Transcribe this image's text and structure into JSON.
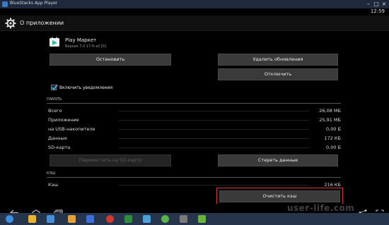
{
  "window": {
    "title": "BlueStacks App Player"
  },
  "status": {
    "time": "12:59"
  },
  "actionbar": {
    "title": "О приложении"
  },
  "app": {
    "name": "Play Маркет",
    "version": "Версия 7.0.17.H-all [0]"
  },
  "buttons": {
    "stop": "Остановить",
    "uninstall_updates": "Удалить обновления",
    "disable": "Отключить",
    "move_sd": "Переместить на SD-карту",
    "clear_data": "Стереть данные",
    "clear_cache": "Очистить кэш"
  },
  "notifications": {
    "label": "Включить уведомления",
    "checked": true
  },
  "memory": {
    "header": "ПАМЯТЬ",
    "rows": [
      {
        "label": "Всего",
        "value": "26,08 МБ"
      },
      {
        "label": "Приложение",
        "value": "25,91 МБ"
      },
      {
        "label": "на USB-накопителе",
        "value": "0,00 Б"
      },
      {
        "label": "Данные",
        "value": "172 КБ"
      },
      {
        "label": "SD-карта",
        "value": "0,00 Б"
      }
    ]
  },
  "cache": {
    "header": "КЭШ",
    "label": "Кэш",
    "value": "216 КБ"
  },
  "watermark": "user-life.com",
  "colors": {
    "highlight": "#d23a3a",
    "taskbar": "#26344c",
    "titlebar": "#1e2a3b"
  }
}
